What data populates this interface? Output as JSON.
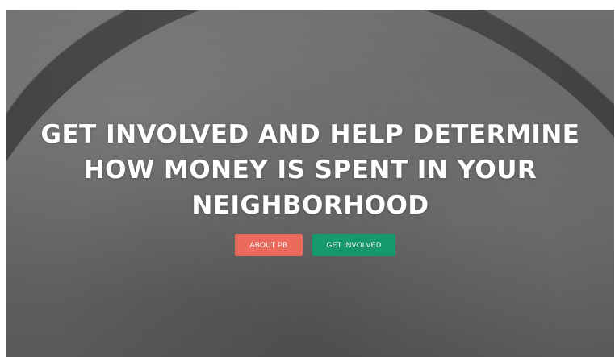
{
  "hero": {
    "headline_lines": [
      "GET INVOLVED AND HELP DETERMINE",
      "HOW MONEY IS SPENT IN YOUR",
      "NEIGHBORHOOD"
    ],
    "background_image": "gateway-arch-grayscale-photo"
  },
  "buttons": {
    "about_label": "ABOUT PB",
    "involved_label": "GET INVOLVED"
  },
  "colors": {
    "about_button": "#ea6a5c",
    "involved_button": "#15996b",
    "headline_text": "#ffffff"
  }
}
